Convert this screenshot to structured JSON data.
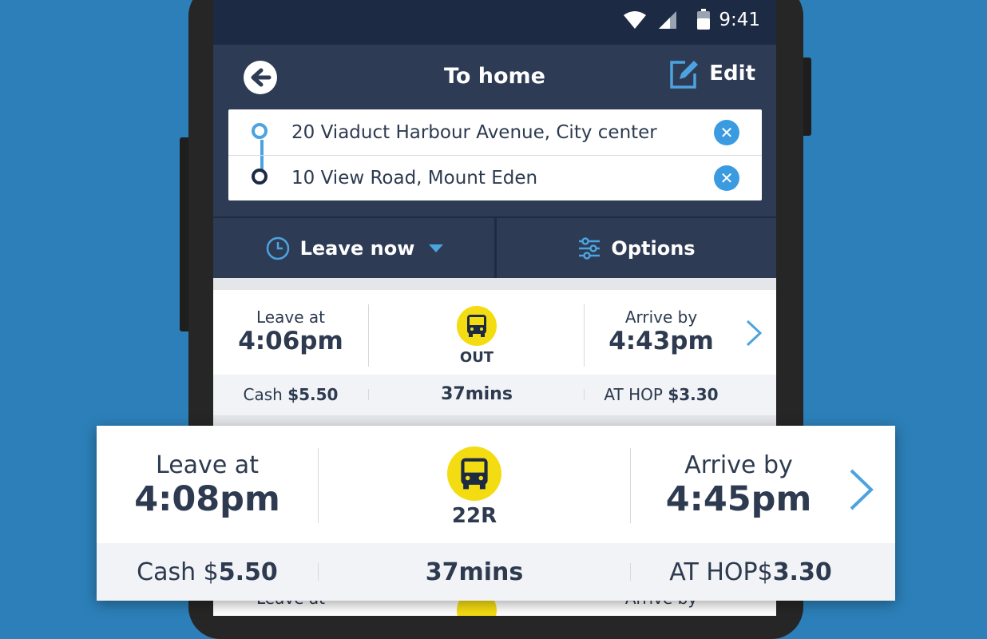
{
  "status": {
    "time": "9:41"
  },
  "header": {
    "title": "To home",
    "edit_label": "Edit"
  },
  "route": {
    "origin": "20 Viaduct Harbour Avenue, City center",
    "destination": "10 View Road, Mount Eden"
  },
  "tabs": {
    "leave": "Leave now",
    "options": "Options"
  },
  "trips": [
    {
      "leave_label": "Leave at",
      "leave_time": "4:06pm",
      "route": "OUT",
      "arrive_label": "Arrive by",
      "arrive_time": "4:43pm",
      "cash_label": "Cash",
      "cash_value": "$5.50",
      "duration": "37mins",
      "hop_label": "AT HOP",
      "hop_value": "$3.30"
    },
    {
      "leave_label": "Leave at",
      "leave_time": "4:08pm",
      "route": "22R",
      "arrive_label": "Arrive by",
      "arrive_time": "4:45pm",
      "cash_label": "Cash $",
      "cash_value": "5.50",
      "duration": "37mins",
      "hop_label": "AT HOP$",
      "hop_value": "3.30"
    },
    {
      "leave_label": "Leave at",
      "arrive_label": "Arrive by"
    }
  ],
  "colors": {
    "accent": "#4da3df",
    "bus": "#f4dc12",
    "header": "#2d3b55",
    "background": "#2c7fb8"
  },
  "icons": [
    "back-arrow-icon",
    "edit-icon",
    "clear-icon",
    "clock-icon",
    "sliders-icon",
    "bus-icon",
    "chevron-right-icon",
    "wifi-icon",
    "signal-icon",
    "battery-icon"
  ]
}
